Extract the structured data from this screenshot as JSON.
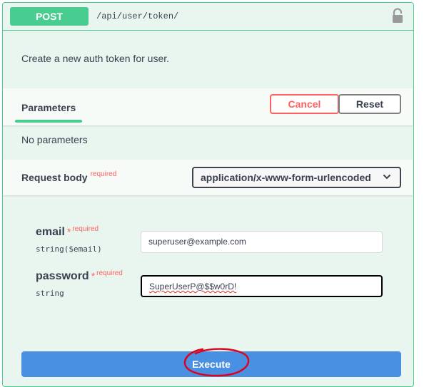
{
  "operation": {
    "method": "POST",
    "path": "/api/user/token/",
    "description": "Create a new auth token for user."
  },
  "parameters": {
    "tab_label": "Parameters",
    "cancel_label": "Cancel",
    "reset_label": "Reset",
    "empty_text": "No parameters"
  },
  "request_body": {
    "title": "Request body",
    "required_label": "required",
    "content_type": "application/x-www-form-urlencoded"
  },
  "fields": {
    "email": {
      "name": "email",
      "asterisk": "*",
      "required_label": "required",
      "type": "string($email)",
      "value": "superuser@example.com"
    },
    "password": {
      "name": "password",
      "asterisk": "*",
      "required_label": "required",
      "type": "string",
      "value": "SuperUserP@$$w0rD!"
    }
  },
  "execute_label": "Execute",
  "colors": {
    "post_green": "#49cc90",
    "panel_bg": "#e8f6ef",
    "cancel_red": "#ff6060",
    "execute_blue": "#4990e2",
    "annotation_red": "#e0001b"
  },
  "icons": [
    "lock-icon",
    "chevron-down-icon"
  ]
}
